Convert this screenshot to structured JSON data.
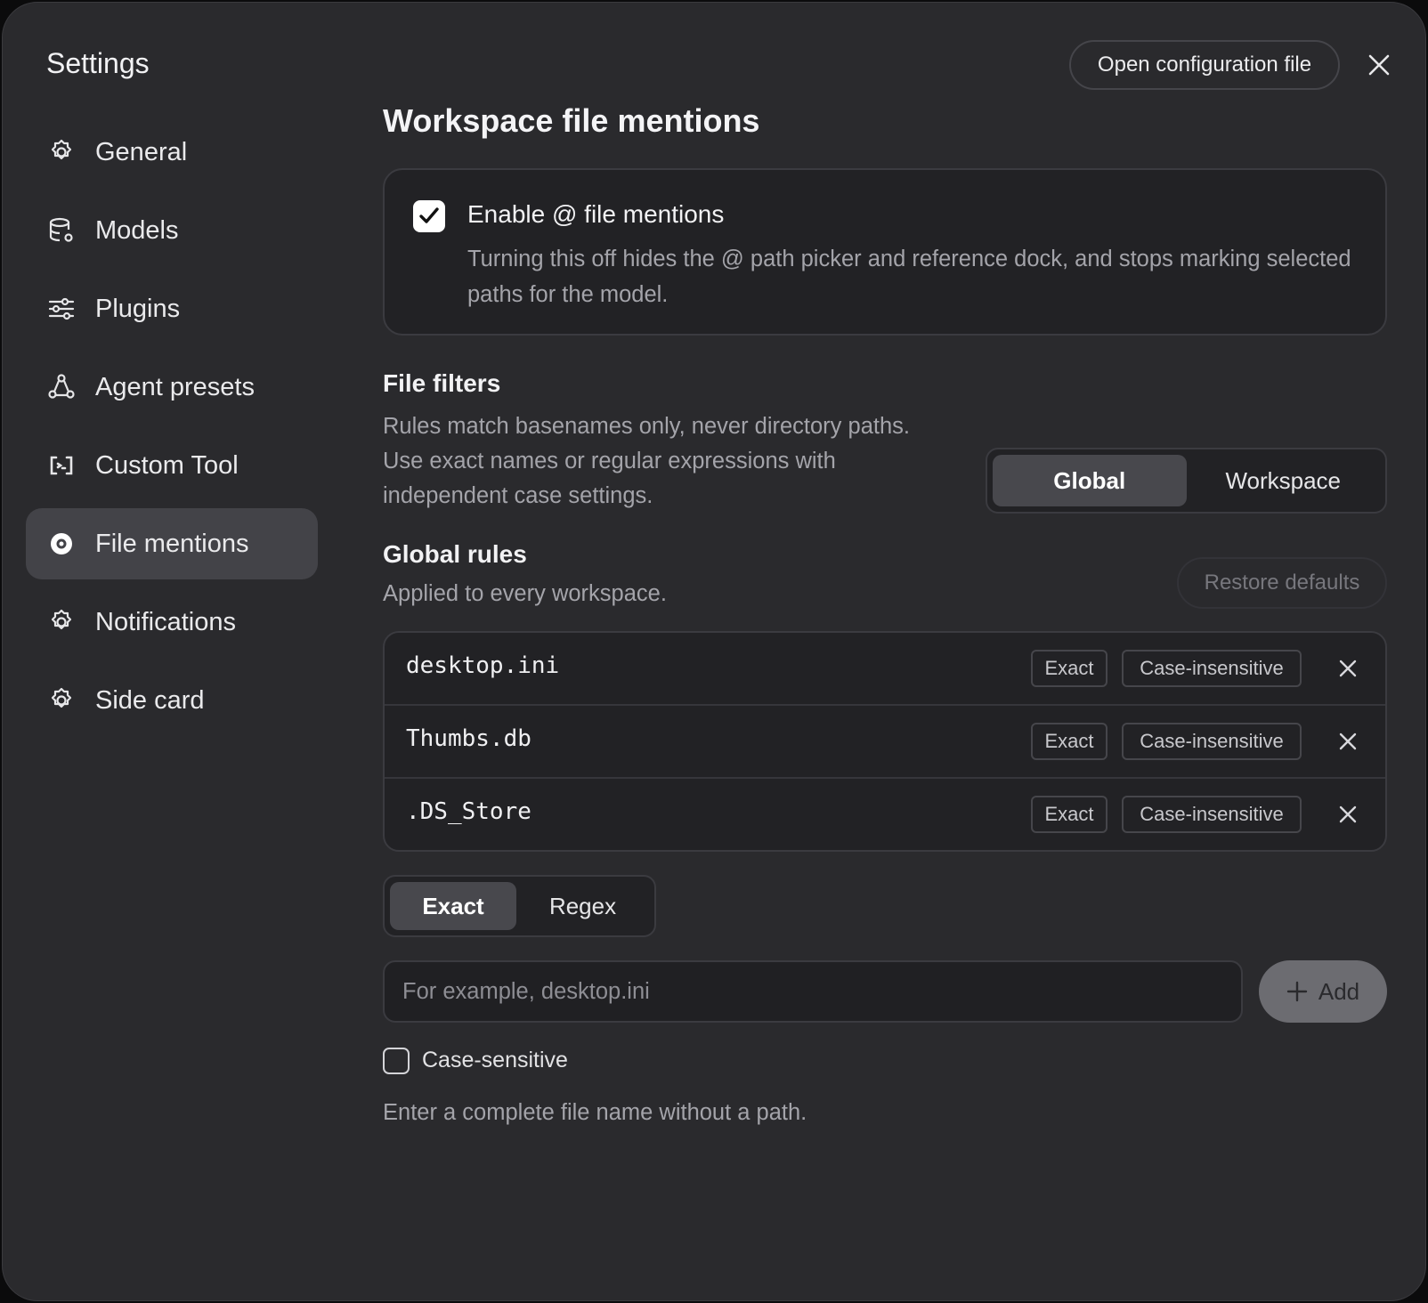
{
  "header": {
    "title": "Settings",
    "open_config_label": "Open configuration file"
  },
  "sidebar": {
    "items": [
      {
        "label": "General",
        "icon": "gear-icon"
      },
      {
        "label": "Models",
        "icon": "database-gear-icon"
      },
      {
        "label": "Plugins",
        "icon": "sliders-icon"
      },
      {
        "label": "Agent presets",
        "icon": "nodes-icon"
      },
      {
        "label": "Custom Tool",
        "icon": "code-bracket-icon"
      },
      {
        "label": "File mentions",
        "icon": "target-icon",
        "active": true
      },
      {
        "label": "Notifications",
        "icon": "gear-icon"
      },
      {
        "label": "Side card",
        "icon": "gear-icon"
      }
    ]
  },
  "main": {
    "title": "Workspace file mentions",
    "enable": {
      "checked": true,
      "label": "Enable @ file mentions",
      "description": "Turning this off hides the @ path picker and reference dock, and stops marking selected paths for the model."
    },
    "file_filters": {
      "title": "File filters",
      "description_lines": [
        "Rules match basenames only, never directory paths.",
        "Use exact names or regular expressions with",
        "independent case settings."
      ],
      "scope_options": [
        "Global",
        "Workspace"
      ],
      "scope_selected": "Global"
    },
    "global_rules": {
      "title": "Global rules",
      "subtitle": "Applied to every workspace.",
      "restore_label": "Restore defaults",
      "rules": [
        {
          "name": "desktop.ini",
          "match": "Exact",
          "case": "Case-insensitive"
        },
        {
          "name": "Thumbs.db",
          "match": "Exact",
          "case": "Case-insensitive"
        },
        {
          "name": ".DS_Store",
          "match": "Exact",
          "case": "Case-insensitive"
        }
      ]
    },
    "new_rule": {
      "mode_options": [
        "Exact",
        "Regex"
      ],
      "mode_selected": "Exact",
      "input_value": "",
      "input_placeholder": "For example, desktop.ini",
      "add_label": "Add",
      "case_sensitive_label": "Case-sensitive",
      "case_sensitive_checked": false,
      "hint": "Enter a complete file name without a path."
    }
  },
  "colors": {
    "window_bg": "#2a2a2d",
    "card_bg": "#222225",
    "active_nav": "#434348",
    "muted_text": "#a4a4aa",
    "add_button": "#6c6c71"
  }
}
